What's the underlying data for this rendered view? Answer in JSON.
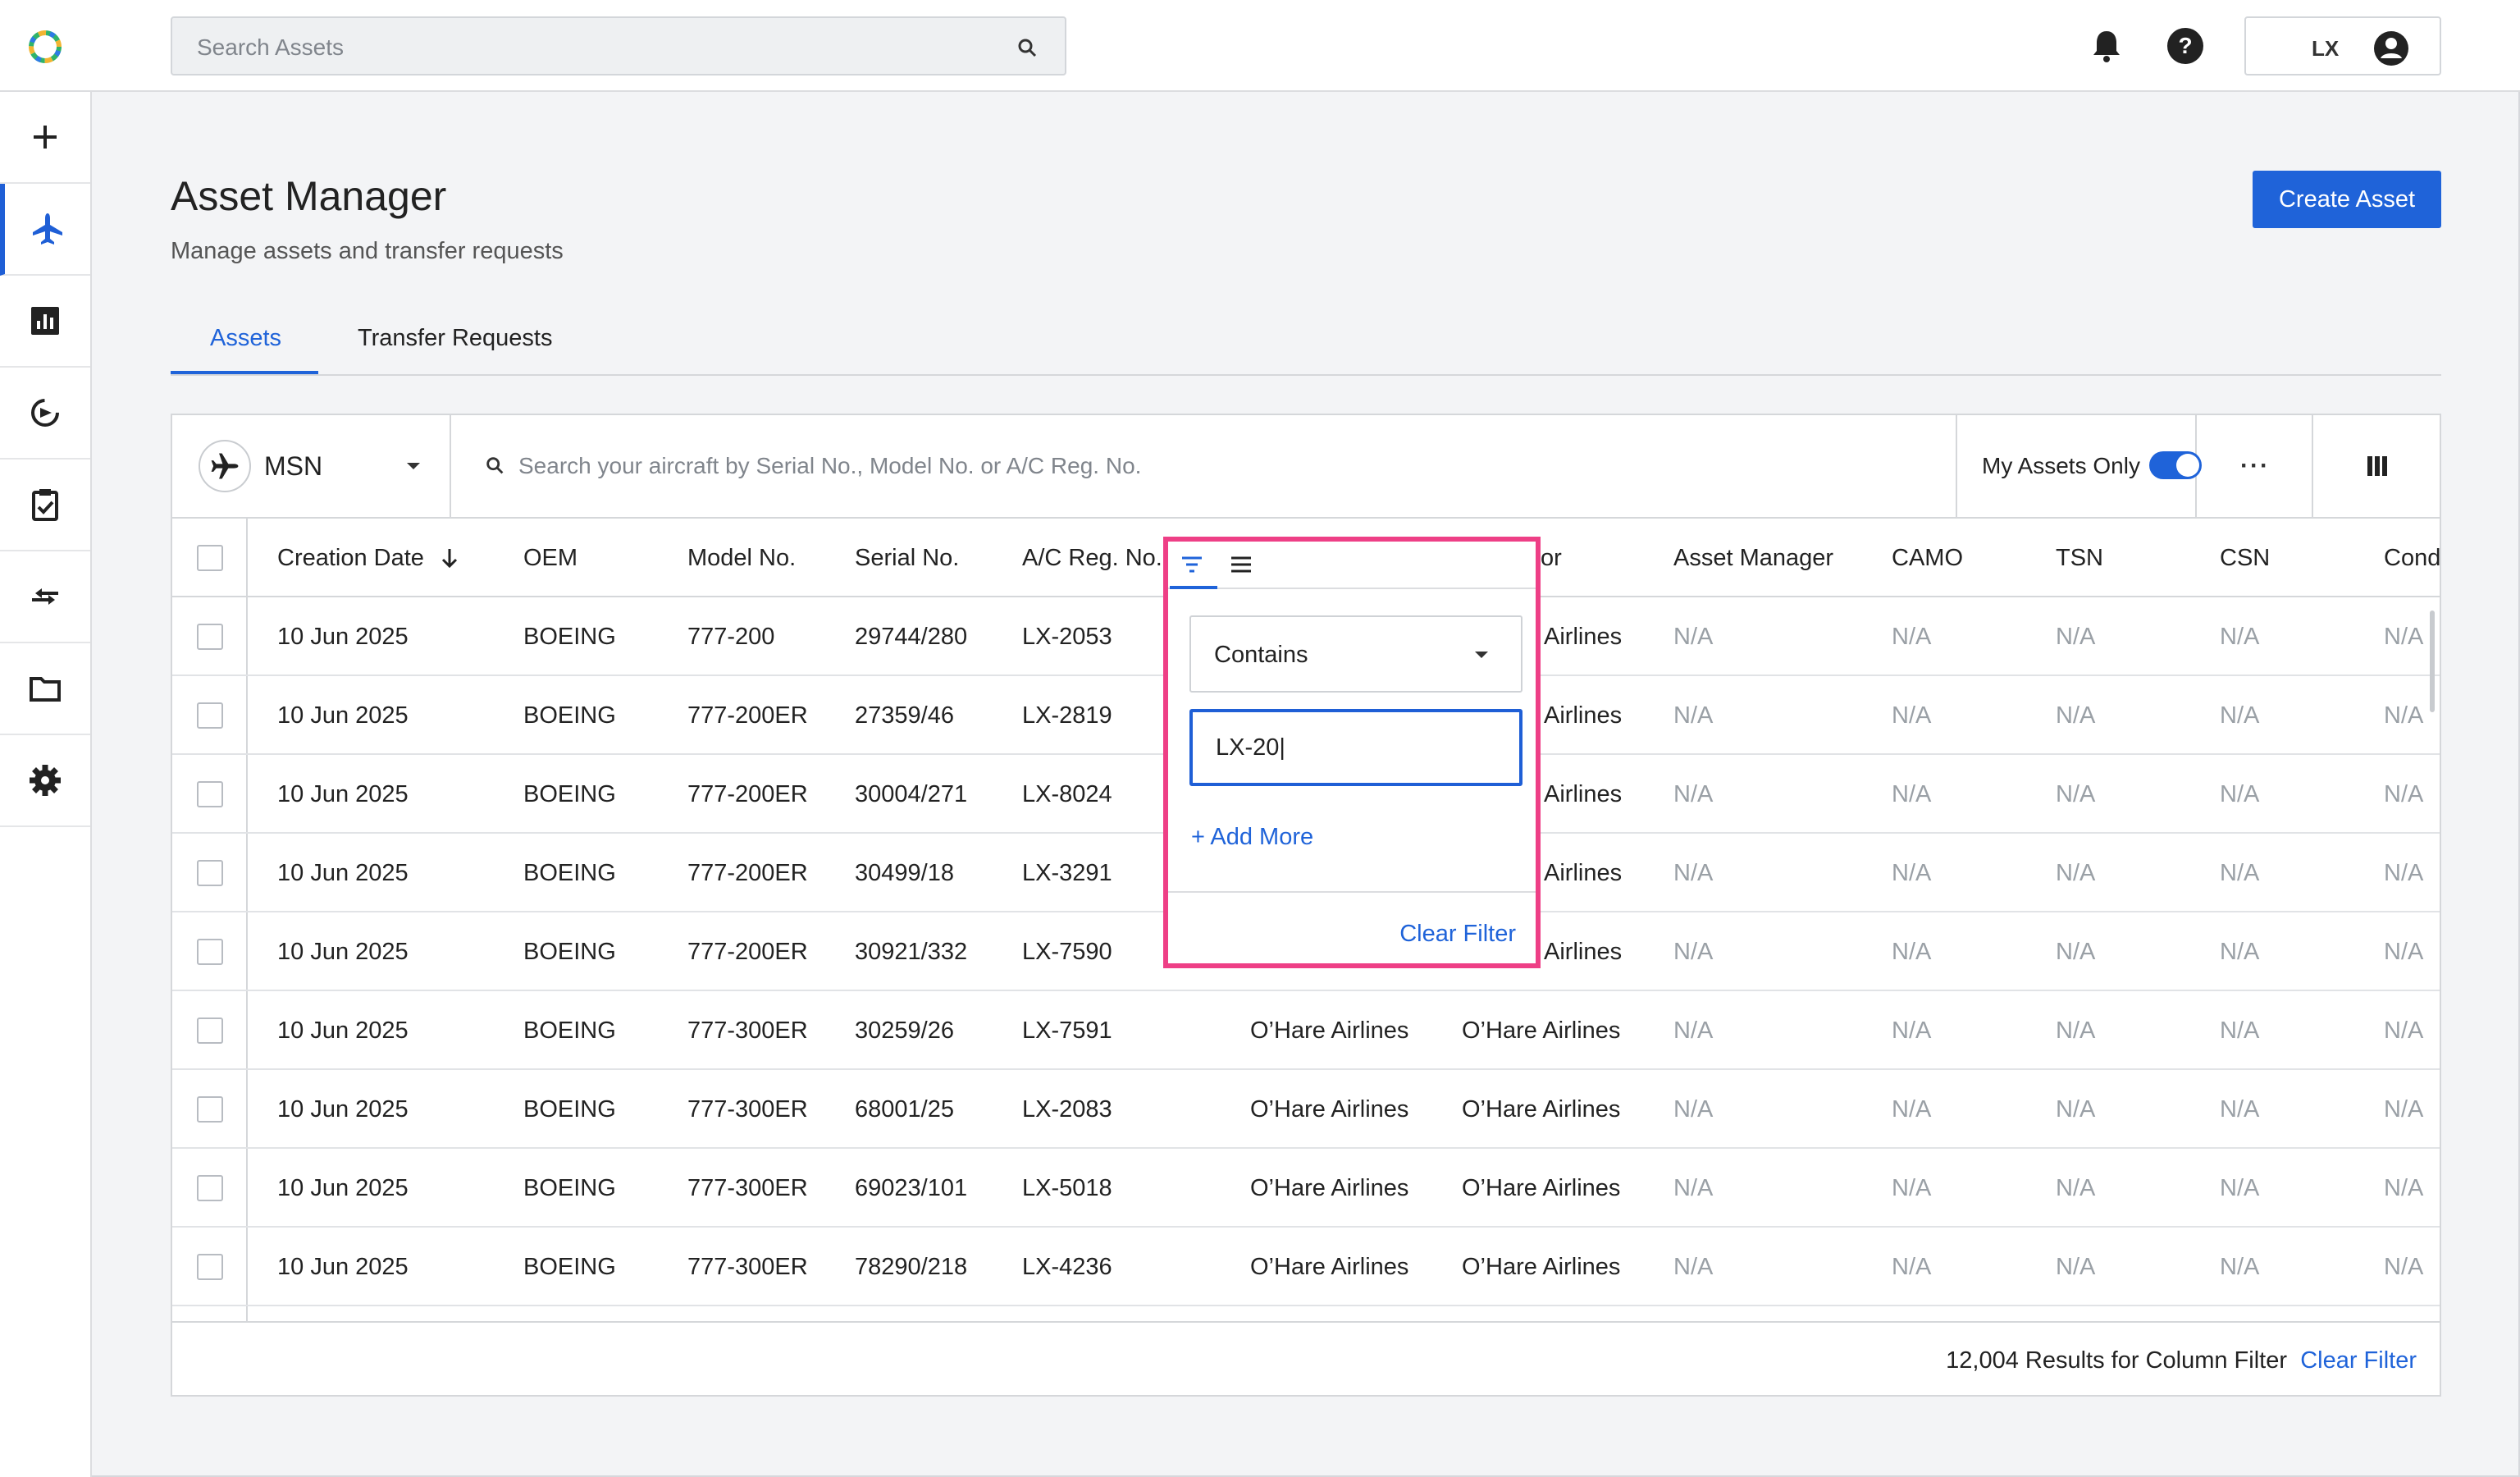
{
  "header": {
    "search_placeholder": "Search Assets",
    "user_initials": "LX"
  },
  "page": {
    "title": "Asset Manager",
    "subtitle": "Manage assets and transfer requests",
    "create_button": "Create Asset"
  },
  "tabs": [
    {
      "label": "Assets",
      "active": true
    },
    {
      "label": "Transfer Requests",
      "active": false
    }
  ],
  "toolbar": {
    "asset_type": "MSN",
    "search_placeholder": "Search your aircraft by Serial No., Model No. or A/C Reg. No.",
    "my_assets_label": "My Assets Only",
    "my_assets_on": true,
    "more_label": "···"
  },
  "table": {
    "columns": {
      "creation_date": "Creation Date",
      "oem": "OEM",
      "model": "Model No.",
      "serial": "Serial No.",
      "reg": "A/C Reg. No.",
      "operator_partial": "or",
      "asset_manager": "Asset Manager",
      "camo": "CAMO",
      "tsn": "TSN",
      "csn": "CSN",
      "cond": "Cond"
    },
    "rows": [
      {
        "date": "10 Jun 2025",
        "oem": "BOEING",
        "model": "777-200",
        "serial": "29744/280",
        "reg": "LX-2053",
        "owner": "",
        "operator": "Airlines",
        "am": "N/A",
        "camo": "N/A",
        "tsn": "N/A",
        "csn": "N/A",
        "cond": "N/A"
      },
      {
        "date": "10 Jun 2025",
        "oem": "BOEING",
        "model": "777-200ER",
        "serial": "27359/46",
        "reg": "LX-2819",
        "owner": "",
        "operator": "Airlines",
        "am": "N/A",
        "camo": "N/A",
        "tsn": "N/A",
        "csn": "N/A",
        "cond": "N/A"
      },
      {
        "date": "10 Jun 2025",
        "oem": "BOEING",
        "model": "777-200ER",
        "serial": "30004/271",
        "reg": "LX-8024",
        "owner": "",
        "operator": "Airlines",
        "am": "N/A",
        "camo": "N/A",
        "tsn": "N/A",
        "csn": "N/A",
        "cond": "N/A"
      },
      {
        "date": "10 Jun 2025",
        "oem": "BOEING",
        "model": "777-200ER",
        "serial": "30499/18",
        "reg": "LX-3291",
        "owner": "",
        "operator": "Airlines",
        "am": "N/A",
        "camo": "N/A",
        "tsn": "N/A",
        "csn": "N/A",
        "cond": "N/A"
      },
      {
        "date": "10 Jun 2025",
        "oem": "BOEING",
        "model": "777-200ER",
        "serial": "30921/332",
        "reg": "LX-7590",
        "owner": "",
        "operator": "Airlines",
        "am": "N/A",
        "camo": "N/A",
        "tsn": "N/A",
        "csn": "N/A",
        "cond": "N/A"
      },
      {
        "date": "10 Jun 2025",
        "oem": "BOEING",
        "model": "777-300ER",
        "serial": "30259/26",
        "reg": "LX-7591",
        "owner": "O’Hare Airlines",
        "operator": "O’Hare Airlines",
        "am": "N/A",
        "camo": "N/A",
        "tsn": "N/A",
        "csn": "N/A",
        "cond": "N/A"
      },
      {
        "date": "10 Jun 2025",
        "oem": "BOEING",
        "model": "777-300ER",
        "serial": "68001/25",
        "reg": "LX-2083",
        "owner": "O’Hare Airlines",
        "operator": "O’Hare Airlines",
        "am": "N/A",
        "camo": "N/A",
        "tsn": "N/A",
        "csn": "N/A",
        "cond": "N/A"
      },
      {
        "date": "10 Jun 2025",
        "oem": "BOEING",
        "model": "777-300ER",
        "serial": "69023/101",
        "reg": "LX-5018",
        "owner": "O’Hare Airlines",
        "operator": "O’Hare Airlines",
        "am": "N/A",
        "camo": "N/A",
        "tsn": "N/A",
        "csn": "N/A",
        "cond": "N/A"
      },
      {
        "date": "10 Jun 2025",
        "oem": "BOEING",
        "model": "777-300ER",
        "serial": "78290/218",
        "reg": "LX-4236",
        "owner": "O’Hare Airlines",
        "operator": "O’Hare Airlines",
        "am": "N/A",
        "camo": "N/A",
        "tsn": "N/A",
        "csn": "N/A",
        "cond": "N/A"
      }
    ]
  },
  "filter_popup": {
    "operator": "Contains",
    "value": "LX-20|",
    "add_more": "+ Add More",
    "clear": "Clear Filter"
  },
  "footer": {
    "results": "12,004 Results for Column Filter",
    "clear": "Clear Filter"
  },
  "icons": {
    "logo": "logo-icon",
    "search": "search-icon",
    "bell": "bell-icon",
    "help": "help-icon",
    "avatar": "user-avatar-icon",
    "nav": [
      "plus-icon",
      "airplane-icon",
      "report-icon",
      "transfer-cycle-icon",
      "clipboard-check-icon",
      "swap-arrows-icon",
      "folder-icon",
      "gear-icon"
    ],
    "columns": "column-chooser-icon",
    "filter": "filter-icon",
    "menu": "menu-lines-icon"
  },
  "colors": {
    "accent": "#1f63d9",
    "highlight": "#ee3f86"
  }
}
